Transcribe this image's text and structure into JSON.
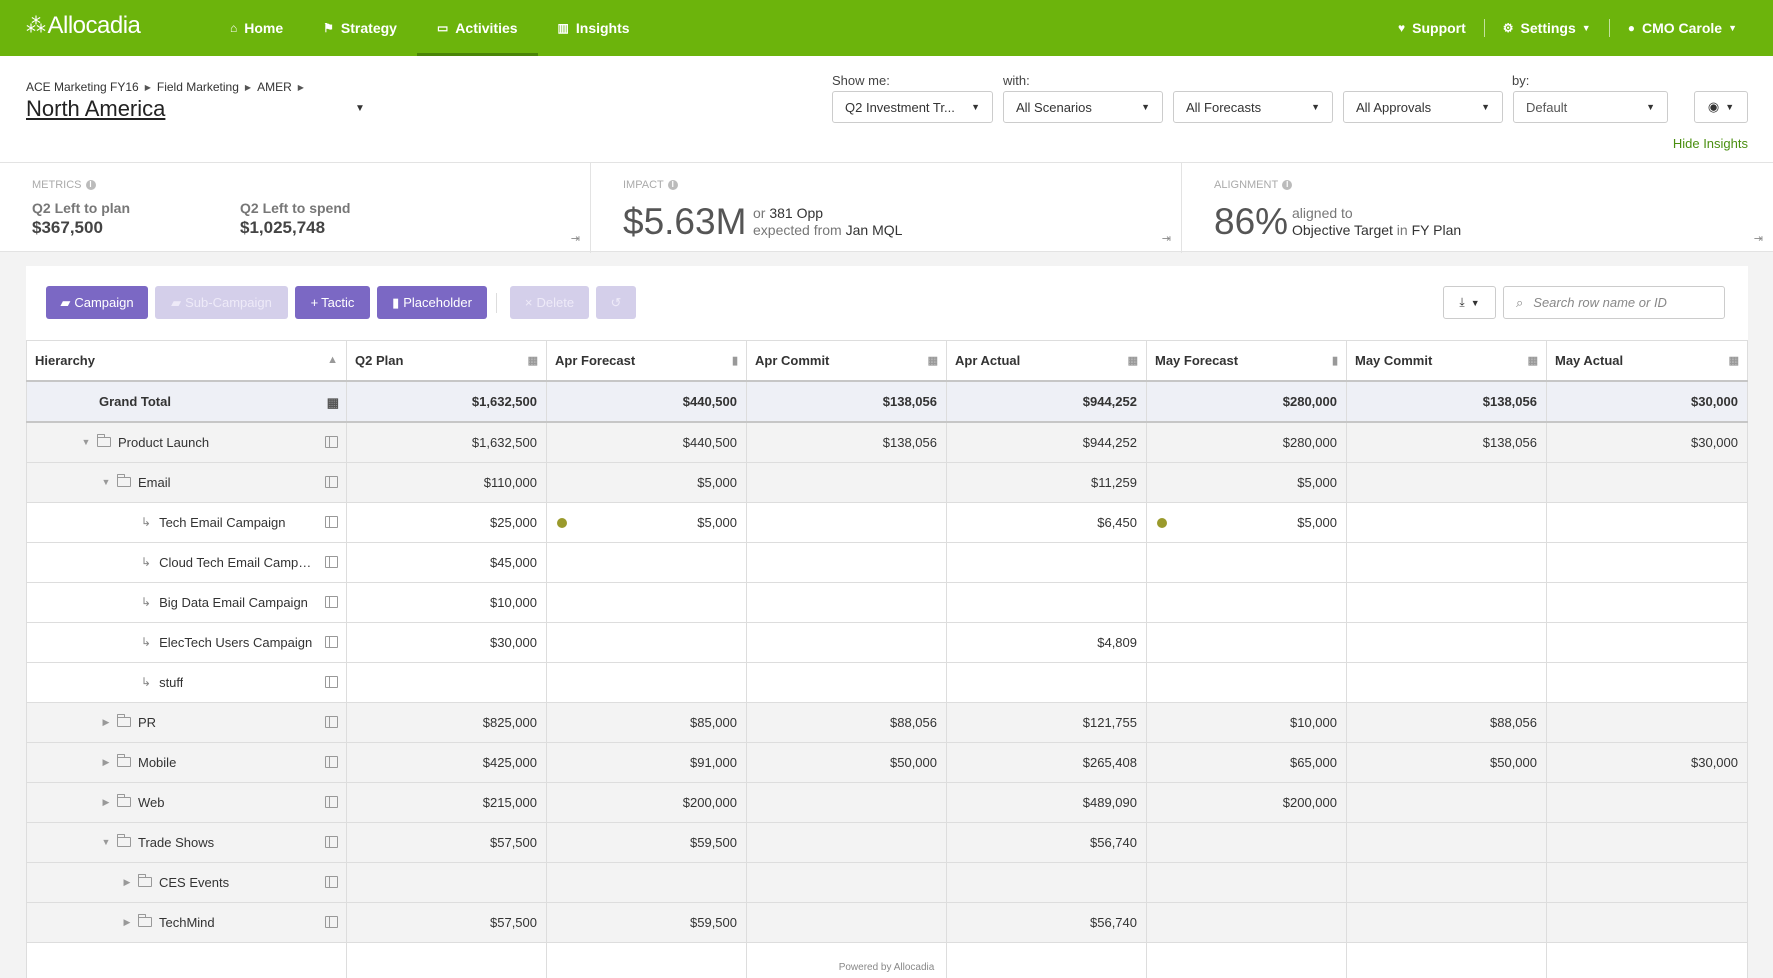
{
  "app": {
    "name": "Allocadia"
  },
  "nav": {
    "items": [
      {
        "label": "Home",
        "icon": "home-icon"
      },
      {
        "label": "Strategy",
        "icon": "flag-icon"
      },
      {
        "label": "Activities",
        "icon": "monitor-icon"
      },
      {
        "label": "Insights",
        "icon": "bar-chart-icon"
      }
    ],
    "active": "Activities",
    "support": "Support",
    "settings": "Settings",
    "user": "CMO Carole"
  },
  "breadcrumb": [
    "ACE Marketing FY16",
    "Field Marketing",
    "AMER"
  ],
  "page_title": "North America",
  "filters": {
    "show_me_label": "Show me:",
    "with_label": "with:",
    "by_label": "by:",
    "show_me": "Q2 Investment Tr...",
    "scenarios": "All Scenarios",
    "forecasts": "All Forecasts",
    "approvals": "All Approvals",
    "by": "Default"
  },
  "hide_insights": "Hide Insights",
  "insights": {
    "metrics": {
      "label": "METRICS",
      "left_to_plan_label": "Q2 Left to plan",
      "left_to_plan": "$367,500",
      "left_to_spend_label": "Q2 Left to spend",
      "left_to_spend": "$1,025,748"
    },
    "impact": {
      "label": "IMPACT",
      "value": "$5.63M",
      "line1_prefix": "or",
      "line1_value": "381 Opp",
      "line2_prefix": "expected from",
      "line2_value": "Jan MQL"
    },
    "alignment": {
      "label": "ALIGNMENT",
      "value": "86%",
      "line1": "aligned to",
      "line2_a": "Objective Target",
      "line2_in": "in",
      "line2_b": "FY Plan"
    }
  },
  "toolbar": {
    "campaign": "Campaign",
    "sub_campaign": "Sub-Campaign",
    "tactic": "Tactic",
    "placeholder": "Placeholder",
    "delete": "Delete",
    "search_placeholder": "Search row name or ID"
  },
  "table": {
    "columns": [
      "Hierarchy",
      "Q2 Plan",
      "Apr Forecast",
      "Apr Commit",
      "Apr Actual",
      "May Forecast",
      "May Commit",
      "May Actual"
    ],
    "grand_total": {
      "label": "Grand Total",
      "values": [
        "$1,632,500",
        "$440,500",
        "$138,056",
        "$944,252",
        "$280,000",
        "$138,056",
        "$30,000"
      ]
    },
    "rows": [
      {
        "label": "Product Launch",
        "values": [
          "$1,632,500",
          "$440,500",
          "$138,056",
          "$944,252",
          "$280,000",
          "$138,056",
          "$30,000"
        ]
      },
      {
        "label": "Email",
        "values": [
          "$110,000",
          "$5,000",
          "",
          "$11,259",
          "$5,000",
          "",
          ""
        ]
      },
      {
        "label": "Tech Email Campaign",
        "values": [
          "$25,000",
          "$5,000",
          "",
          "$6,450",
          "$5,000",
          "",
          ""
        ]
      },
      {
        "label": "Cloud Tech Email Camp…",
        "values": [
          "$45,000",
          "",
          "",
          "",
          "",
          "",
          ""
        ]
      },
      {
        "label": "Big Data Email Campaign",
        "values": [
          "$10,000",
          "",
          "",
          "",
          "",
          "",
          ""
        ]
      },
      {
        "label": "ElecTech Users Campaign",
        "values": [
          "$30,000",
          "",
          "",
          "$4,809",
          "",
          "",
          ""
        ]
      },
      {
        "label": "stuff",
        "values": [
          "",
          "",
          "",
          "",
          "",
          "",
          ""
        ]
      },
      {
        "label": "PR",
        "values": [
          "$825,000",
          "$85,000",
          "$88,056",
          "$121,755",
          "$10,000",
          "$88,056",
          ""
        ]
      },
      {
        "label": "Mobile",
        "values": [
          "$425,000",
          "$91,000",
          "$50,000",
          "$265,408",
          "$65,000",
          "$50,000",
          "$30,000"
        ]
      },
      {
        "label": "Web",
        "values": [
          "$215,000",
          "$200,000",
          "",
          "$489,090",
          "$200,000",
          "",
          ""
        ]
      },
      {
        "label": "Trade Shows",
        "values": [
          "$57,500",
          "$59,500",
          "",
          "$56,740",
          "",
          "",
          ""
        ]
      },
      {
        "label": "CES Events",
        "values": [
          "",
          "",
          "",
          "",
          "",
          "",
          ""
        ]
      },
      {
        "label": "TechMind",
        "values": [
          "$57,500",
          "$59,500",
          "",
          "$56,740",
          "",
          "",
          ""
        ]
      }
    ]
  },
  "footer": "Powered by Allocadia",
  "colors": {
    "brand_green": "#6cb40c",
    "button_purple": "#7b68c4",
    "status_dot": "#9a9a2c"
  }
}
